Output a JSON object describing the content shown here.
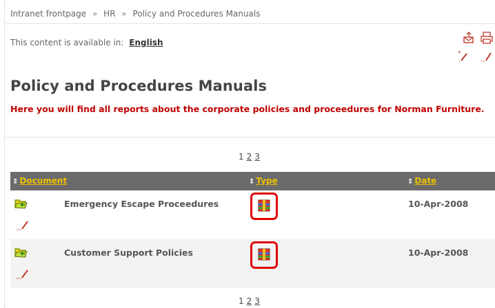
{
  "breadcrumb": {
    "items": [
      "Intranet frontpage",
      "HR",
      "Policy and Procedures Manuals"
    ],
    "separator": "»"
  },
  "availability": {
    "label": "This content is available in:",
    "language": "English"
  },
  "toolbar": {
    "icons": [
      "send-email-icon",
      "print-icon",
      "new-item-icon",
      "edit-icon"
    ]
  },
  "page": {
    "title": "Policy and Procedures Manuals",
    "intro": "Here you will find all reports about the corporate policies and proceedures for Norman Furniture.",
    "intro_color": "#c00000"
  },
  "pager": {
    "current": "1",
    "pages": [
      "2",
      "3"
    ]
  },
  "table": {
    "sort_glyph": "⇕",
    "header_bg": "#6b6b6b",
    "header_link_color": "#f0c000",
    "columns": [
      "Document",
      "Type",
      "Date"
    ],
    "rows": [
      {
        "document": "Emergency Escape Proceedures",
        "type_icon": "archive-icon",
        "date": "10-Apr-2008"
      },
      {
        "document": "Customer Support Policies",
        "type_icon": "archive-icon",
        "date": "10-Apr-2008"
      }
    ]
  },
  "highlight_color": "#e00000"
}
